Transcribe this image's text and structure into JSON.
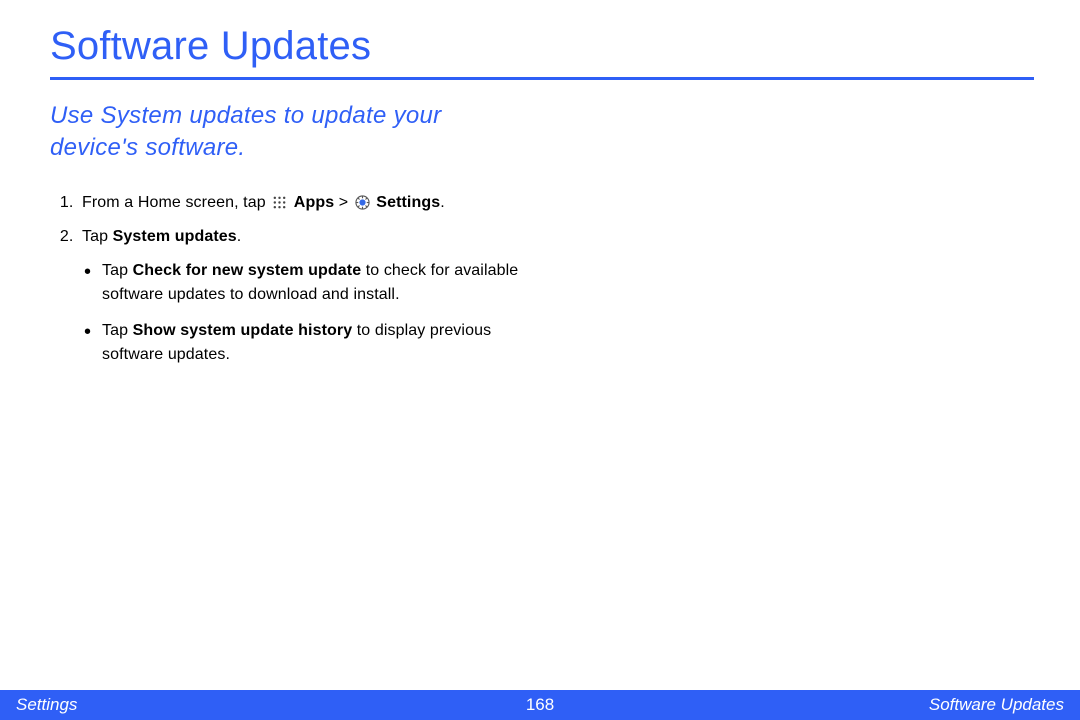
{
  "title": "Software Updates",
  "subtitle": "Use System updates to update your device's software.",
  "steps": {
    "step1": {
      "part_a": "From a Home screen, tap ",
      "apps_label": "Apps",
      "separator": " > ",
      "settings_label": "Settings",
      "end": "."
    },
    "step2": {
      "part_a": "Tap ",
      "bold": "System updates",
      "end": "."
    }
  },
  "bullets": {
    "b1": {
      "part_a": "Tap ",
      "bold": "Check for new system update",
      "part_b": " to check for available software updates to download and install."
    },
    "b2": {
      "part_a": "Tap ",
      "bold": "Show system update history",
      "part_b": " to display previous software updates."
    }
  },
  "footer": {
    "left": "Settings",
    "center": "168",
    "right": "Software Updates"
  }
}
